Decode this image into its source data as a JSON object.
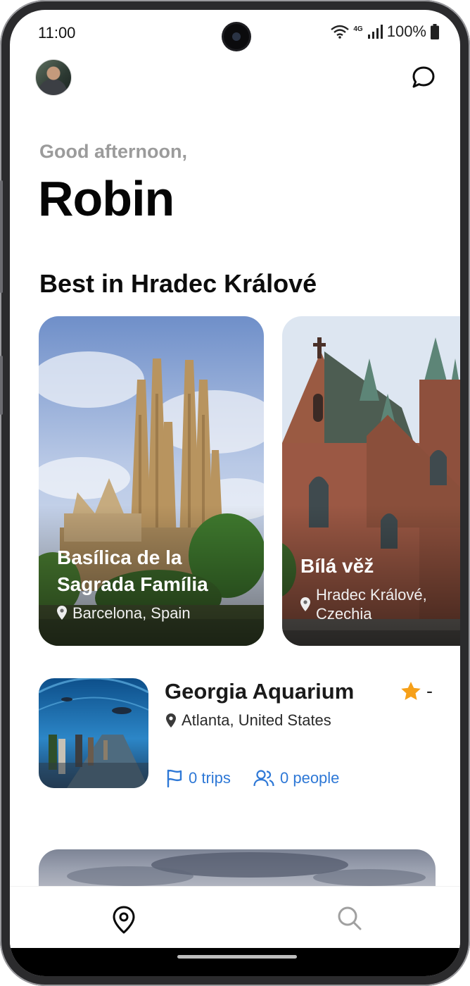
{
  "status_bar": {
    "time": "11:00",
    "network": "4G",
    "battery": "100%"
  },
  "header": {
    "greeting": "Good afternoon,",
    "name": "Robin"
  },
  "section": {
    "title": "Best in Hradec Králové"
  },
  "featured": [
    {
      "title_line1": "Basílica de la",
      "title_line2": "Sagrada Família",
      "location": "Barcelona, Spain"
    },
    {
      "title_line1": "Bílá věž",
      "location_line1": "Hradec Králové,",
      "location_line2": "Czechia"
    }
  ],
  "list": [
    {
      "title": "Georgia Aquarium",
      "rating": "-",
      "location": "Atlanta, United States",
      "trips": "0 trips",
      "people": "0 people"
    }
  ],
  "colors": {
    "accent": "#2e78d6",
    "star": "#f6a019",
    "text": "#0c0c0c",
    "muted": "#9b9b9b"
  },
  "icons": [
    "avatar",
    "chat-icon",
    "location-pin-icon",
    "star-icon",
    "flag-icon",
    "people-icon",
    "map-pin-nav-icon",
    "search-icon"
  ]
}
